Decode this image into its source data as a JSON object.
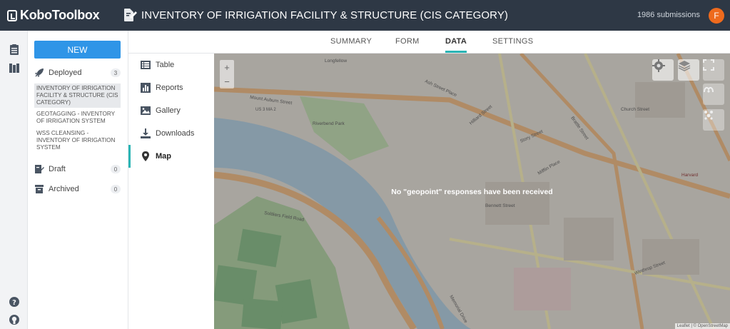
{
  "app": {
    "logo_text": "KoboToolbox"
  },
  "header": {
    "form_title": "INVENTORY OF IRRIGATION FACILITY & STRUCTURE (CIS CATEGORY)",
    "submissions": "1986 submissions",
    "avatar_letter": "F"
  },
  "sidebar": {
    "new_label": "NEW",
    "deployed": {
      "label": "Deployed",
      "count": "3"
    },
    "projects": [
      "INVENTORY OF IRRIGATION FACILITY & STRUCTURE (CIS CATEGORY)",
      "GEOTAGGING - INVENTORY OF IRRIGATION SYSTEM",
      "WSS CLEANSING - INVENTORY OF IRRIGATION SYSTEM"
    ],
    "draft": {
      "label": "Draft",
      "count": "0"
    },
    "archived": {
      "label": "Archived",
      "count": "0"
    }
  },
  "tabs": [
    "SUMMARY",
    "FORM",
    "DATA",
    "SETTINGS"
  ],
  "active_tab": "DATA",
  "submenu": [
    "Table",
    "Reports",
    "Gallery",
    "Downloads",
    "Map"
  ],
  "active_submenu": "Map",
  "map": {
    "message": "No \"geopoint\" responses have been received",
    "zoom_in": "+",
    "zoom_out": "−",
    "attribution": "Leaflet | © OpenStreetMap",
    "labels": [
      "Mount Auburn Street",
      "Ash Street Place",
      "Longfellow",
      "Brattle Street",
      "Church Street",
      "Riverbend Park",
      "Soldiers Field Road",
      "Harvard",
      "Mifflin Place",
      "Story Street",
      "Hilliard Street",
      "Bennett Street",
      "Winthrop Street",
      "Memorial Drive",
      "US 3 MA 2"
    ]
  },
  "colors": {
    "header_bg": "#2e3845",
    "primary": "#2f95e7",
    "accent": "#2bb5b5",
    "avatar": "#ee6a1d"
  }
}
